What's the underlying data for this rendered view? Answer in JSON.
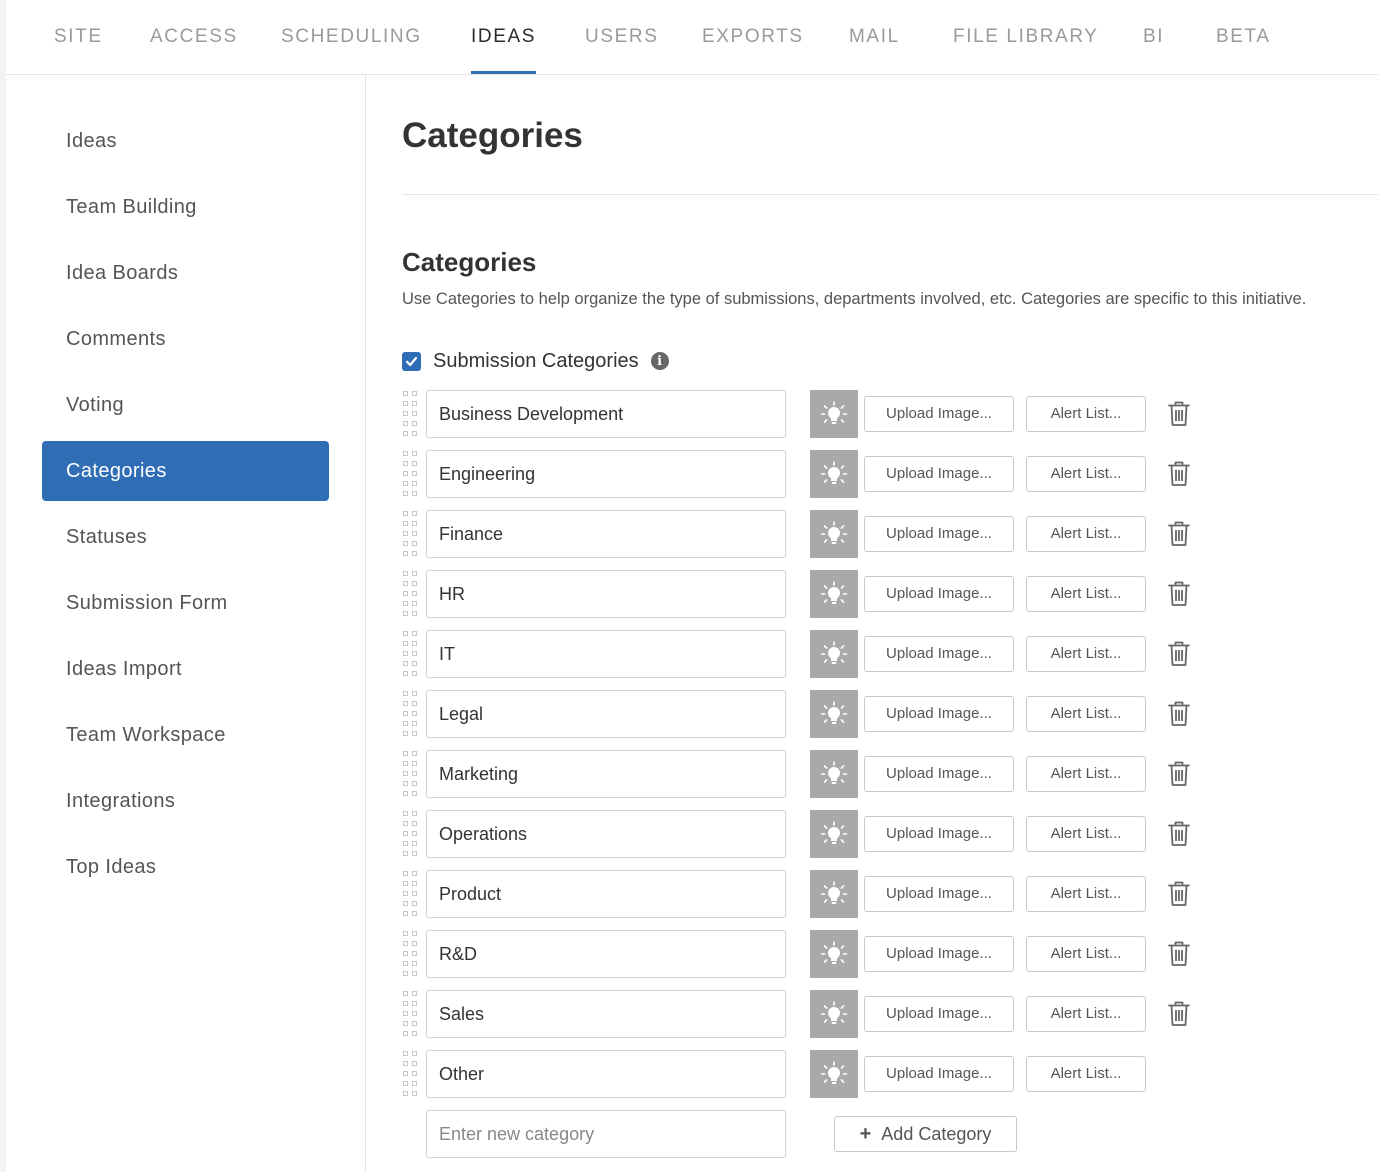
{
  "top_nav": {
    "tabs": [
      {
        "label": "SITE"
      },
      {
        "label": "ACCESS"
      },
      {
        "label": "SCHEDULING"
      },
      {
        "label": "IDEAS"
      },
      {
        "label": "USERS"
      },
      {
        "label": "EXPORTS"
      },
      {
        "label": "MAIL"
      },
      {
        "label": "FILE LIBRARY"
      },
      {
        "label": "BI"
      },
      {
        "label": "BETA"
      }
    ],
    "active": "IDEAS"
  },
  "sidebar": {
    "items": [
      {
        "label": "Ideas"
      },
      {
        "label": "Team Building"
      },
      {
        "label": "Idea Boards"
      },
      {
        "label": "Comments"
      },
      {
        "label": "Voting"
      },
      {
        "label": "Categories"
      },
      {
        "label": "Statuses"
      },
      {
        "label": "Submission Form"
      },
      {
        "label": "Ideas Import"
      },
      {
        "label": "Team Workspace"
      },
      {
        "label": "Integrations"
      },
      {
        "label": "Top Ideas"
      }
    ],
    "active": "Categories"
  },
  "main": {
    "page_title": "Categories",
    "section_title": "Categories",
    "section_description": "Use Categories to help organize the type of submissions, departments involved, etc. Categories are specific to this initiative.",
    "submission_categories": {
      "label": "Submission Categories",
      "checked": true
    },
    "upload_label": "Upload Image...",
    "alert_label": "Alert List...",
    "categories": [
      {
        "name": "Business Development",
        "deletable": true
      },
      {
        "name": "Engineering",
        "deletable": true
      },
      {
        "name": "Finance",
        "deletable": true
      },
      {
        "name": "HR",
        "deletable": true
      },
      {
        "name": "IT",
        "deletable": true
      },
      {
        "name": "Legal",
        "deletable": true
      },
      {
        "name": "Marketing",
        "deletable": true
      },
      {
        "name": "Operations",
        "deletable": true
      },
      {
        "name": "Product",
        "deletable": true
      },
      {
        "name": "R&D",
        "deletable": true
      },
      {
        "name": "Sales",
        "deletable": true
      },
      {
        "name": "Other",
        "deletable": false
      }
    ],
    "new_category_placeholder": "Enter new category",
    "add_category_label": "Add Category"
  },
  "colors": {
    "accent": "#2f6db5",
    "bulb_bg": "#a9a9a9"
  },
  "icons": [
    "info-icon",
    "drag-handle-icon",
    "lightbulb-icon",
    "trash-icon",
    "plus-icon",
    "checkmark-icon"
  ]
}
